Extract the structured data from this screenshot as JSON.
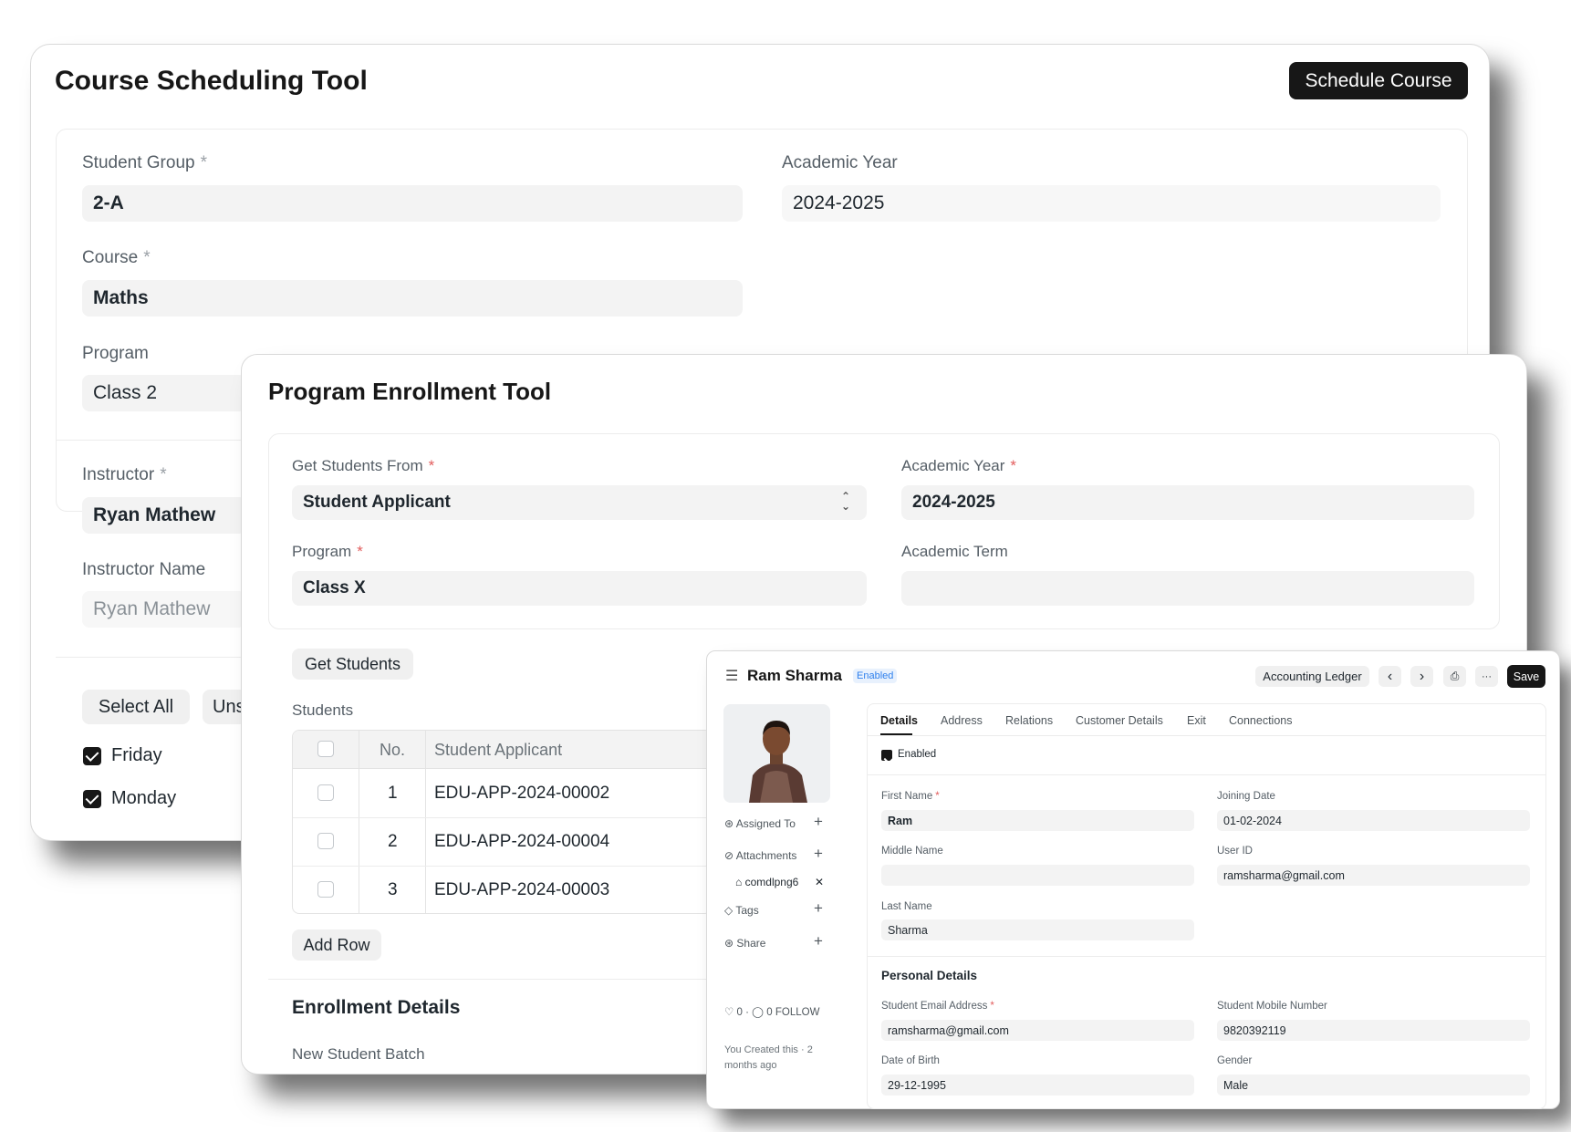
{
  "scheduling": {
    "title": "Course Scheduling Tool",
    "schedule_button": "Schedule Course",
    "student_group_label": "Student Group",
    "student_group_value": "2-A",
    "academic_year_label": "Academic Year",
    "academic_year_value": "2024-2025",
    "course_label": "Course",
    "course_value": "Maths",
    "program_label": "Program",
    "program_value": "Class 2",
    "instructor_label": "Instructor",
    "instructor_value": "Ryan Mathew",
    "instructor_name_label": "Instructor Name",
    "instructor_name_value": "Ryan Mathew",
    "select_all": "Select All",
    "unselect_all_partial": "Uns",
    "days": [
      {
        "label": "Friday",
        "checked": true
      },
      {
        "label": "Monday",
        "checked": true
      }
    ],
    "required_mark": "*"
  },
  "enrollment": {
    "title": "Program Enrollment Tool",
    "get_students_from_label": "Get Students From",
    "get_students_from_value": "Student Applicant",
    "academic_year_label": "Academic Year",
    "academic_year_value": "2024-2025",
    "program_label": "Program",
    "program_value": "Class X",
    "academic_term_label": "Academic Term",
    "academic_term_value": "",
    "get_students_button": "Get Students",
    "students_label": "Students",
    "table": {
      "col_no": "No.",
      "col_applicant": "Student Applicant",
      "rows": [
        {
          "no": "1",
          "applicant": "EDU-APP-2024-00002"
        },
        {
          "no": "2",
          "applicant": "EDU-APP-2024-00004"
        },
        {
          "no": "3",
          "applicant": "EDU-APP-2024-00003"
        }
      ]
    },
    "add_row_button": "Add Row",
    "enrollment_details_heading": "Enrollment Details",
    "new_student_batch_label": "New Student Batch",
    "required_mark": "*"
  },
  "student": {
    "name": "Ram Sharma",
    "status_badge": "Enabled",
    "accounting_ledger_button": "Accounting Ledger",
    "more_button": "···",
    "save_button": "Save",
    "tabs": [
      "Details",
      "Address",
      "Relations",
      "Customer Details",
      "Exit",
      "Connections"
    ],
    "active_tab": "Details",
    "enabled_checkbox_label": "Enabled",
    "sidebar": {
      "assigned_to": "Assigned To",
      "attachments": "Attachments",
      "attachment_file": "comdlpng6",
      "tags": "Tags",
      "share": "Share",
      "likes": "0",
      "comments": "0",
      "follow": "FOLLOW",
      "created_line1": "You Created this · 2",
      "created_line2": "months ago"
    },
    "fields": {
      "first_name_label": "First Name",
      "first_name_value": "Ram",
      "joining_date_label": "Joining Date",
      "joining_date_value": "01-02-2024",
      "middle_name_label": "Middle Name",
      "middle_name_value": "",
      "user_id_label": "User ID",
      "user_id_value": "ramsharma@gmail.com",
      "last_name_label": "Last Name",
      "last_name_value": "Sharma"
    },
    "personal_details_heading": "Personal Details",
    "personal": {
      "email_label": "Student Email Address",
      "email_value": "ramsharma@gmail.com",
      "mobile_label": "Student Mobile Number",
      "mobile_value": "9820392119",
      "dob_label": "Date of Birth",
      "dob_value": "29-12-1995",
      "gender_label": "Gender",
      "gender_value": "Male"
    },
    "required_mark": "*",
    "colors": {
      "badge_text": "#2f80ed",
      "badge_bg": "#e8f1fd",
      "dark_button": "#171717"
    }
  }
}
